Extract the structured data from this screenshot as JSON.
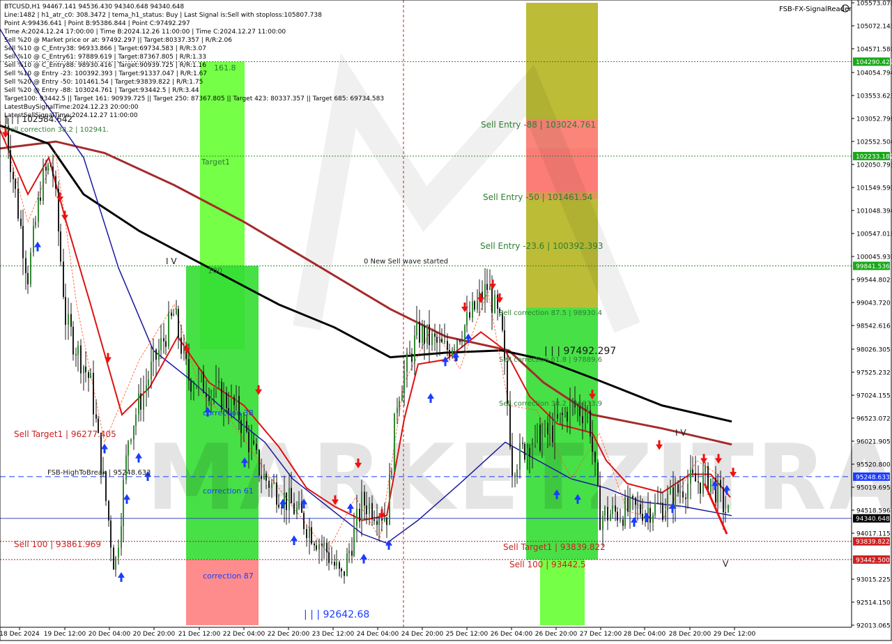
{
  "header": {
    "lines": [
      "BTCUSD,H1  94467.141 94536.430 94340.648 94340.648",
      "Line:1482 | h1_atr_c0: 308.3472 | tema_h1_status: Buy | Last Signal is:Sell with stoploss:105807.738",
      "Point A:99436.641 | Point B:95386.844 | Point C:97492.297",
      "Time A:2024.12.24 17:00:00 | Time B:2024.12.26 11:00:00 | Time C:2024.12.27 11:00:00",
      "Sell %20 @ Market price or at: 97492.297 || Target:80337.357 | R/R:2.06",
      "Sell %10 @ C_Entry38: 96933.866 | Target:69734.583 | R/R:3.07",
      "Sell %10 @ C_Entry61: 97889.619 | Target:87367.805 | R/R:1.33",
      "Sell %10 @ C_Entry88: 98930.416 | Target:90939.725 | R/R:1.16",
      "Sell %10 @ Entry -23: 100392.393 | Target:91337.047 | R/R:1.67",
      "Sell %20 @ Entry -50: 101461.54 | Target:93839.822 | R/R:1.75",
      "Sell %20 @ Entry -88: 103024.761 | Target:93442.5 | R/R:3.44",
      "Target100: 93442.5 || Target 161: 90939.725 || Target 250: 87367.805 || Target 423: 80337.357 || Target 685: 69734.583",
      "LatestBuySignalTime:2024.12.23 20:00:00",
      "LatestSellSignalTime:2024.12.27 11:00:00"
    ]
  },
  "brand": "FSB-FX-SignalReader",
  "watermark": "MARKETZITRADE",
  "chart_data": {
    "type": "candlestick",
    "symbol": "BTCUSD",
    "timeframe": "H1",
    "ylim": [
      92013.065,
      105573.078
    ],
    "y_ticks": [
      "105573.078",
      "105072.145",
      "104571.580",
      "104290.429",
      "104054.794",
      "103553.625",
      "103052.796",
      "102552.504",
      "102233.182",
      "102050.793",
      "101549.590",
      "101048.394",
      "100547.018",
      "100045.930",
      "99841.536",
      "99544.802",
      "99043.720",
      "98542.616",
      "98026.305",
      "97525.232",
      "97024.155",
      "96523.072",
      "96021.905",
      "95520.800",
      "95248.633",
      "95019.695",
      "94518.596",
      "94340.648",
      "94017.115",
      "93839.822",
      "93442.500",
      "93015.225",
      "92514.150",
      "92013.065"
    ],
    "x_ticks": [
      "18 Dec 2024",
      "19 Dec 12:00",
      "20 Dec 04:00",
      "20 Dec 20:00",
      "21 Dec 12:00",
      "22 Dec 04:00",
      "22 Dec 20:00",
      "23 Dec 12:00",
      "24 Dec 04:00",
      "24 Dec 20:00",
      "25 Dec 12:00",
      "26 Dec 04:00",
      "26 Dec 20:00",
      "27 Dec 12:00",
      "28 Dec 04:00",
      "28 Dec 20:00",
      "29 Dec 12:00"
    ],
    "price_tags": [
      {
        "value": 104290.429,
        "label": "104290.429",
        "color": "#18a818"
      },
      {
        "value": 102233.182,
        "label": "102233.182",
        "color": "#18a818"
      },
      {
        "value": 99841.536,
        "label": "99841.536",
        "color": "#18a818"
      },
      {
        "value": 95248.633,
        "label": "95248.633",
        "color": "#1a3cff"
      },
      {
        "value": 94340.648,
        "label": "94340.648",
        "color": "#000000"
      },
      {
        "value": 93839.822,
        "label": "93839.822",
        "color": "#cc2020"
      },
      {
        "value": 93442.5,
        "label": "93442.500",
        "color": "#cc2020"
      }
    ],
    "levels": [
      {
        "value": 104290.429,
        "color": "#2e8b2e",
        "style": "dotted"
      },
      {
        "value": 102233.182,
        "color": "#2e8b2e",
        "style": "dotted"
      },
      {
        "value": 99841.536,
        "color": "#2e8b2e",
        "style": "dotted"
      },
      {
        "value": 95248.633,
        "color": "#1a3cff",
        "style": "dashed"
      },
      {
        "value": 94340.648,
        "color": "#3a4bbf",
        "style": "solid"
      },
      {
        "value": 93839.822,
        "color": "#a02020",
        "style": "dotted"
      },
      {
        "value": 93442.5,
        "color": "#a02020",
        "style": "dotted"
      }
    ],
    "labels": [
      {
        "text": "Sell Entry -88 | 103024.761",
        "color": "#2e7d32",
        "size": 12
      },
      {
        "text": "Sell Entry -50 | 101461.54",
        "color": "#2e7d32",
        "size": 12
      },
      {
        "text": "Sell Entry -23.6 | 100392.393",
        "color": "#2e7d32",
        "size": 12
      },
      {
        "text": "Sell correction 87.5 | 98930.4",
        "color": "#2e7d32",
        "size": 10
      },
      {
        "text": "Sell correction 61.8 | 97889.6",
        "color": "#2e7d32",
        "size": 10
      },
      {
        "text": "Sell correction 38.2 | 96933.9",
        "color": "#2e7d32",
        "size": 10
      },
      {
        "text": "| | | 97492.297",
        "color": "#1a1a1a",
        "size": 14
      },
      {
        "text": "Sell Target1 | 93839.822",
        "color": "#cc2020",
        "size": 12
      },
      {
        "text": "Sell 100 | 93442.5",
        "color": "#cc2020",
        "size": 12
      },
      {
        "text": "Sell Target1 | 96277.405",
        "color": "#cc2020",
        "size": 12
      },
      {
        "text": "Sell 100 | 93861.969",
        "color": "#cc2020",
        "size": 12
      },
      {
        "text": "FSB-HighToBreak | 95248.633",
        "color": "#1a1a1a",
        "size": 10
      },
      {
        "text": "Sell correction 38.2 | 102941.",
        "color": "#2e7d32",
        "size": 10
      },
      {
        "text": "| | | 102584.642",
        "color": "#1a1a1a",
        "size": 12
      },
      {
        "text": "0 New Sell wave started",
        "color": "#1a1a1a",
        "size": 10
      },
      {
        "text": "Target1",
        "color": "#2e7d32",
        "size": 11
      },
      {
        "text": "161.8",
        "color": "#2e7d32",
        "size": 11
      },
      {
        "text": "100",
        "color": "#2e7d32",
        "size": 11
      },
      {
        "text": "correction 38",
        "color": "#1a3cff",
        "size": 11
      },
      {
        "text": "correction 61",
        "color": "#1a3cff",
        "size": 11
      },
      {
        "text": "correction 87",
        "color": "#1a3cff",
        "size": 11
      },
      {
        "text": "| | | 92642.68",
        "color": "#1a3cff",
        "size": 14
      },
      {
        "text": "I V",
        "color": "#1a1a1a",
        "size": 12
      },
      {
        "text": "I V",
        "color": "#1a1a1a",
        "size": 12
      },
      {
        "text": "V",
        "color": "#1a1a1a",
        "size": 12
      }
    ],
    "zones": [
      {
        "name": "sell-zone-upper",
        "color": "#b5b520",
        "bottom": 98930.4,
        "top": 105573.078
      },
      {
        "name": "sell-zone-red",
        "color": "#ff8080",
        "bottom": 101461.54,
        "top": 103024.761
      },
      {
        "name": "sell-zone-green",
        "color": "#33dd33",
        "bottom": 93442.5,
        "top": 98930.4
      },
      {
        "name": "buy-zone-green-upper",
        "color": "#66ff33",
        "bottom": 98026.305,
        "top": 104290.429
      },
      {
        "name": "buy-zone-green-main",
        "color": "#33dd33",
        "bottom": 93442.5,
        "top": 99841.536
      },
      {
        "name": "buy-zone-red-lower",
        "color": "#ff8080",
        "bottom": 92013.065,
        "top": 93442.5
      },
      {
        "name": "sell-zone-green-lower",
        "color": "#66ff33",
        "bottom": 92013.065,
        "top": 93442.5
      }
    ]
  }
}
